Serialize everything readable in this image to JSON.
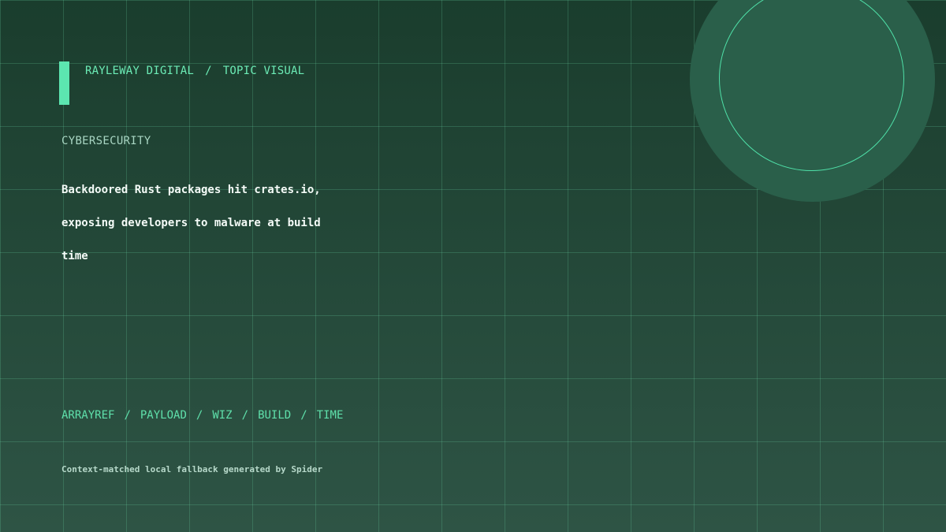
{
  "header": {
    "brand": "RAYLEWAY DIGITAL",
    "separator": "/",
    "section": "TOPIC VISUAL"
  },
  "category": "CYBERSECURITY",
  "headline": {
    "lines": [
      "Backdoored Rust packages hit crates.io,",
      "exposing developers to malware at build",
      "time"
    ]
  },
  "tags": {
    "separator": "/",
    "items": [
      "ARRAYREF",
      "PAYLOAD",
      "WIZ",
      "BUILD",
      "TIME"
    ]
  },
  "footer": {
    "text": "Context-matched local fallback generated by Spider"
  },
  "colors": {
    "background_top": "#1a3d2d",
    "background_bottom": "#2e5445",
    "accent": "#5ce6b0",
    "grid_line": "#6edcaa",
    "orb_fill": "#2a5f4a"
  }
}
